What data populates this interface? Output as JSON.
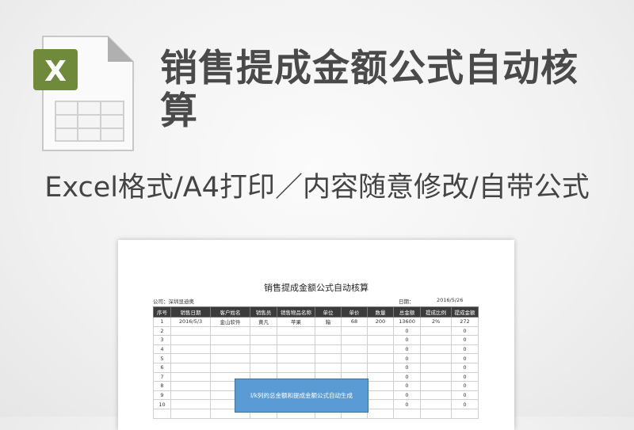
{
  "icon": {
    "name": "excel-file-icon",
    "letter": "X",
    "accent": "#6e8a3a"
  },
  "title": "销售提成金额公式自动核算",
  "subtitle": "Excel格式/A4打印／内容随意修改/自带公式",
  "sheet": {
    "title": "销售提成金额公式自动核算",
    "company_label": "公司：深圳显迪奥",
    "date_label": "日期：",
    "date_value": "2016/5/26",
    "headers": [
      "序号",
      "销售日期",
      "客户姓名",
      "销售员",
      "销售物品名称",
      "单位",
      "单价",
      "数量",
      "总金额",
      "提成比例",
      "提成金额"
    ],
    "rows": [
      [
        "1",
        "2016/5/3",
        "金山软件",
        "黄凡",
        "苹果",
        "箱",
        "68",
        "200",
        "13600",
        "2%",
        "272"
      ],
      [
        "2",
        "",
        "",
        "",
        "",
        "",
        "",
        "",
        "0",
        "",
        "0"
      ],
      [
        "3",
        "",
        "",
        "",
        "",
        "",
        "",
        "",
        "0",
        "",
        "0"
      ],
      [
        "4",
        "",
        "",
        "",
        "",
        "",
        "",
        "",
        "0",
        "",
        "0"
      ],
      [
        "5",
        "",
        "",
        "",
        "",
        "",
        "",
        "",
        "0",
        "",
        "0"
      ],
      [
        "6",
        "",
        "",
        "",
        "",
        "",
        "",
        "",
        "0",
        "",
        "0"
      ],
      [
        "7",
        "",
        "",
        "",
        "",
        "",
        "",
        "",
        "0",
        "",
        "0"
      ],
      [
        "8",
        "",
        "",
        "",
        "",
        "",
        "",
        "",
        "0",
        "",
        "0"
      ],
      [
        "9",
        "",
        "",
        "",
        "",
        "",
        "",
        "",
        "0",
        "",
        "0"
      ],
      [
        "10",
        "",
        "",
        "",
        "",
        "",
        "",
        "",
        "0",
        "",
        "0"
      ],
      [
        "",
        "",
        "",
        "",
        "",
        "",
        "",
        "",
        "",
        "",
        ""
      ]
    ],
    "callout": "I/k列的总金额和提成金额公式自动生成"
  }
}
